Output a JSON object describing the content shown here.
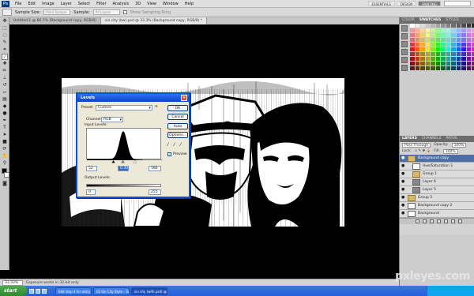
{
  "app": {
    "logo": "Ps",
    "title": "Adobe Photoshop CS5"
  },
  "menu": [
    "File",
    "Edit",
    "Image",
    "Layer",
    "Select",
    "Filter",
    "Analysis",
    "3D",
    "View",
    "Window",
    "Help"
  ],
  "workspaces": [
    "ESSENTIALS",
    "DESIGN",
    "PAINTING"
  ],
  "options": {
    "sample_size_label": "Sample Size:",
    "sample_size_value": "Point Sample",
    "sample_label": "Sample:",
    "sample_value": "All Layers",
    "show_ring_label": "Show Sampling Ring"
  },
  "tabs": [
    {
      "label": "Untitled-1 @ 66.7% (Background copy, RGB/8)",
      "active": false
    },
    {
      "label": "sin city (bw).psd @ 33.3% (Background copy, RGB/8) *",
      "active": true
    }
  ],
  "status": {
    "zoom": "33.33%",
    "info": "Exposure works in 32-bit only"
  },
  "panels": {
    "swatches": {
      "tabs": [
        "COLOR",
        "SWATCHES",
        "STYLES"
      ],
      "active": "SWATCHES"
    },
    "layers": {
      "tabs": [
        "LAYERS",
        "CHANNELS",
        "PATHS"
      ],
      "blend_mode": "Pass Through",
      "opacity_label": "Opacity:",
      "opacity_value": "100%",
      "lock_label": "Lock:",
      "fill_label": "Fill:",
      "fill_value": "100%",
      "rows": [
        {
          "name": "Background copy",
          "selected": true,
          "indent": false,
          "thumb": "folder"
        },
        {
          "name": "Hue/Saturation 1",
          "selected": false,
          "indent": true,
          "thumb": "white"
        },
        {
          "name": "Group 1",
          "selected": false,
          "indent": true,
          "thumb": "folder"
        },
        {
          "name": "Layer 6",
          "selected": false,
          "indent": true,
          "thumb": "dark"
        },
        {
          "name": "Layer 5",
          "selected": false,
          "indent": true,
          "thumb": "dark"
        },
        {
          "name": "Group 3",
          "selected": false,
          "indent": false,
          "thumb": "folder"
        },
        {
          "name": "Background copy 2",
          "selected": false,
          "indent": false,
          "thumb": "white"
        },
        {
          "name": "Background",
          "selected": false,
          "indent": false,
          "thumb": "white"
        }
      ]
    }
  },
  "levels_dialog": {
    "title": "Levels",
    "preset_label": "Preset:",
    "preset_value": "Custom",
    "channel_label": "Channel:",
    "channel_value": "RGB",
    "input_label": "Input Levels:",
    "input_black": "52",
    "input_mid": "0.30",
    "input_white": "186",
    "output_label": "Output Levels:",
    "output_black": "0",
    "output_white": "255",
    "buttons": [
      "OK",
      "Cancel",
      "Auto",
      "Options..."
    ],
    "preview_label": "Preview",
    "preview_checked": true,
    "histogram_peak_fraction": 0.9
  },
  "taskbar": {
    "start": "start",
    "tasks": [
      {
        "label": "Edit step 4 for entry c...",
        "active": false
      },
      {
        "label": "03 Sin City Style - Tu...",
        "active": false
      },
      {
        "label": "sin city (with.psd) @ 3...",
        "active": true
      }
    ]
  },
  "watermark": "pxleyes.com",
  "colors": {
    "accent": "#0b50d8",
    "selected_layer": "#4d6fa6",
    "panel_header": "#6c6c6c"
  }
}
